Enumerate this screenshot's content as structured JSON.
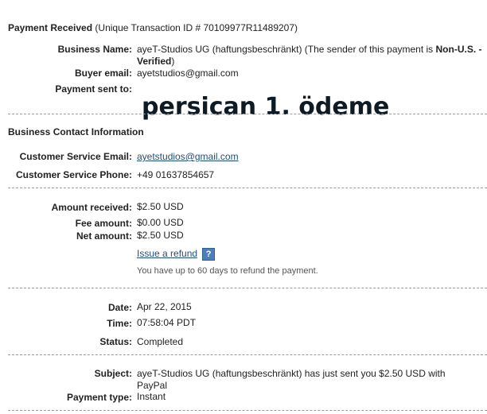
{
  "header": {
    "title": "Payment Received",
    "transaction": "(Unique Transaction ID # 70109977R11489207)"
  },
  "overlay": {
    "caption": "persican 1. ödeme"
  },
  "business": {
    "name_label": "Business Name:",
    "name_value": "ayeT-Studios UG (haftungsbeschränkt) (The sender of this payment is ",
    "name_status": "Non-U.S. - Verified",
    "name_suffix": ")",
    "buyer_email_label": "Buyer email:",
    "buyer_email_value": "ayetstudios@gmail.com",
    "payment_sent_label": "Payment sent to:"
  },
  "contact": {
    "heading": "Business Contact Information",
    "cs_email_label": "Customer Service Email:",
    "cs_email_value": "ayetstudios@gmail.com",
    "cs_phone_label": "Customer Service Phone:",
    "cs_phone_value": "+49 01637854657"
  },
  "amounts": {
    "received_label": "Amount received:",
    "received_value": "$2.50 USD",
    "fee_label": "Fee amount:",
    "fee_value": "$0.00 USD",
    "net_label": "Net amount:",
    "net_value": "$2.50 USD",
    "refund_link": "Issue a refund",
    "help_icon": "?",
    "refund_note": "You have up to 60 days to refund the payment."
  },
  "details": {
    "date_label": "Date:",
    "date_value": "Apr 22, 2015",
    "time_label": "Time:",
    "time_value": "07:58:04 PDT",
    "status_label": "Status:",
    "status_value": "Completed"
  },
  "subject": {
    "subject_label": "Subject:",
    "subject_value": "ayeT-Studios UG (haftungsbeschränkt) has just sent you $2.50 USD with PayPal",
    "payment_type_label": "Payment type:",
    "payment_type_value": "Instant"
  }
}
